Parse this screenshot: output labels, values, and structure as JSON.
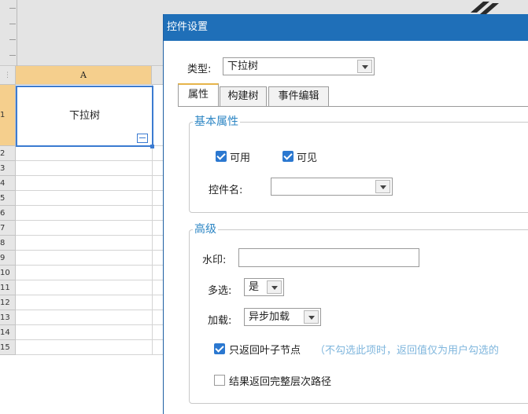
{
  "sheet": {
    "column_a_header": "A",
    "row_numbers": [
      "1",
      "2",
      "3",
      "4",
      "5",
      "6",
      "7",
      "8",
      "9",
      "10",
      "11",
      "12",
      "13",
      "14",
      "15"
    ],
    "cell_a1_value": "下拉树",
    "corner_glyph": "⋮"
  },
  "dialog": {
    "title": "控件设置",
    "type_label": "类型:",
    "type_value": "下拉树",
    "tabs": [
      {
        "label": "属性",
        "active": true
      },
      {
        "label": "构建树",
        "active": false
      },
      {
        "label": "事件编辑",
        "active": false
      }
    ],
    "basic": {
      "title": "基本属性",
      "enabled_label": "可用",
      "enabled_checked": true,
      "visible_label": "可见",
      "visible_checked": true,
      "widget_name_label": "控件名:",
      "widget_name_value": ""
    },
    "advanced": {
      "title": "高级",
      "watermark_label": "水印:",
      "watermark_value": "",
      "multiselect_label": "多选:",
      "multiselect_value": "是",
      "load_label": "加载:",
      "load_value": "异步加载",
      "leaf_only_label": "只返回叶子节点",
      "leaf_only_checked": true,
      "leaf_only_hint": "（不勾选此项时，返回值仅为用户勾选的",
      "full_path_label": "结果返回完整层次路径",
      "full_path_checked": false
    }
  },
  "colors": {
    "titlebar": "#1f6fb8",
    "group_title": "#2d86c4",
    "checkbox": "#2b78d0",
    "selected_header": "#f5cf8d",
    "hint_text": "#7fb6dd"
  }
}
